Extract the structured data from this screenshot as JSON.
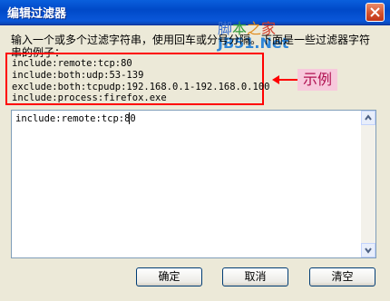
{
  "window": {
    "title": "编辑过滤器"
  },
  "watermark": {
    "chars": [
      "脚",
      "本",
      "之",
      "家"
    ],
    "site": "JB51.Net"
  },
  "instructions": {
    "line1": "输入一个或多个过滤字符串，使用回车或分号分隔。下面是一些过滤器字符",
    "line2": "串的例子："
  },
  "examples": [
    "include:remote:tcp:80",
    "include:both:udp:53-139",
    "exclude:both:tcpudp:192.168.0.1-192.168.0.100",
    "include:process:firefox.exe"
  ],
  "annotation": {
    "label": "示例",
    "color": "#ff0000"
  },
  "filter_input": {
    "value": "include:remote:tcp:80"
  },
  "buttons": {
    "ok_label": "确定",
    "cancel_label": "取消",
    "clear_label": "清空"
  },
  "colors": {
    "titlebar": "#0a5fdc",
    "dialog_bg": "#ece9d8"
  }
}
